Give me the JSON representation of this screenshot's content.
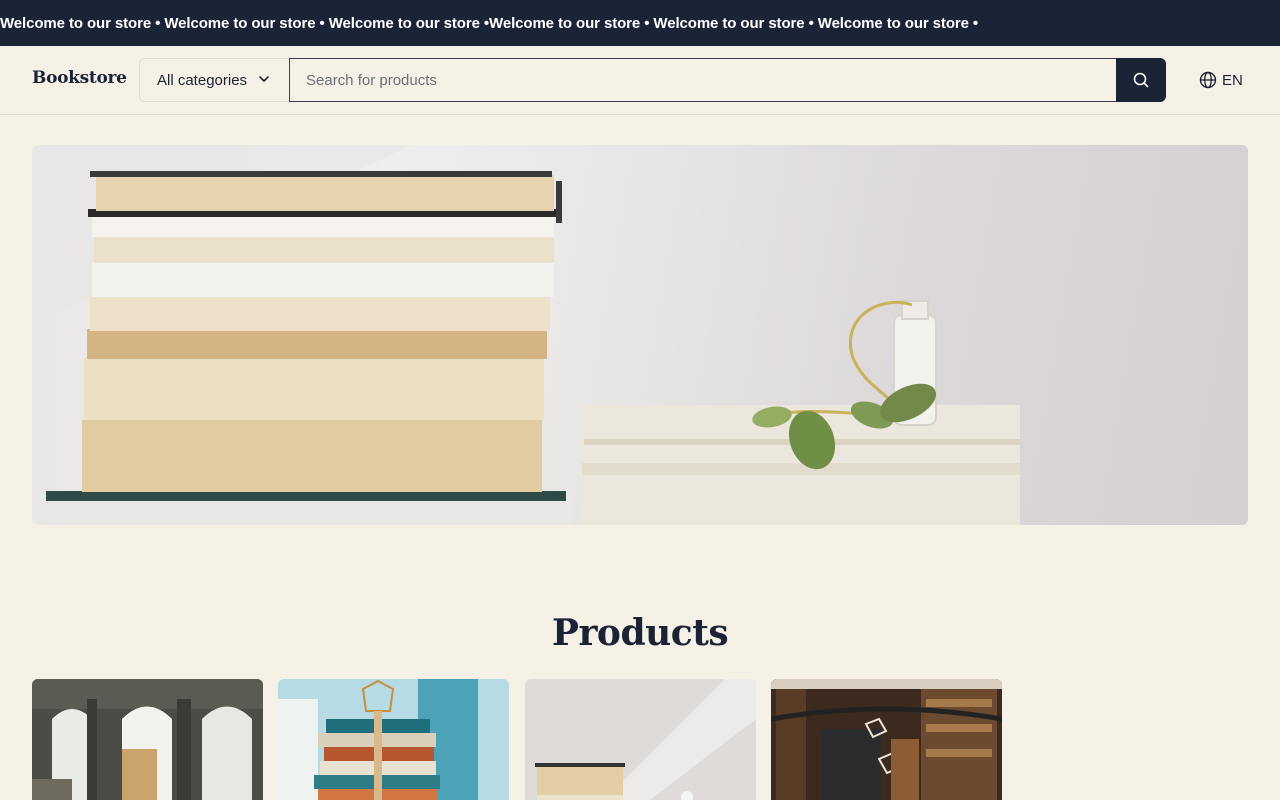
{
  "ticker": {
    "text": "Welcome to our store • Welcome to our store • Welcome to our store •Welcome to our store • Welcome to our store • Welcome to our store •"
  },
  "header": {
    "brand": "Bookstore",
    "category_select": "All categories",
    "search_placeholder": "Search for products",
    "language": "EN"
  },
  "main": {
    "section_title": "Products"
  },
  "colors": {
    "dark": "#1b2336",
    "background": "#f6f1e7"
  }
}
